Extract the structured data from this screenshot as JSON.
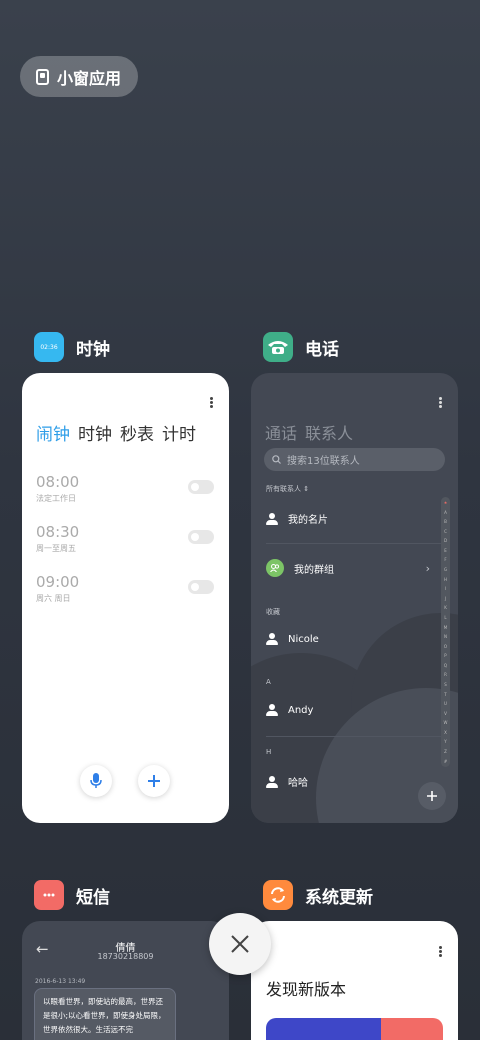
{
  "small_window": {
    "label": "小窗应用"
  },
  "apps": {
    "clock": {
      "name": "时钟",
      "icon_text": "02:36",
      "icon_color": "#36b8f0",
      "tabs": [
        "闹钟",
        "时钟",
        "秒表",
        "计时"
      ],
      "alarms": [
        {
          "time": "08:00",
          "days": "法定工作日",
          "enabled": false
        },
        {
          "time": "08:30",
          "days": "周一至周五",
          "enabled": false
        },
        {
          "time": "09:00",
          "days": "周六 周日",
          "enabled": false
        }
      ]
    },
    "phone": {
      "name": "电话",
      "icon_color": "#3fae88",
      "tabs": [
        "通话",
        "联系人"
      ],
      "search_placeholder": "搜索13位联系人",
      "all_contacts_label": "所有联系人",
      "my_card": "我的名片",
      "my_group": "我的群组",
      "favorites_label": "收藏",
      "contacts": [
        {
          "section": "",
          "name": "Nicole"
        },
        {
          "section": "A",
          "name": "Andy"
        },
        {
          "section": "H",
          "name": "哈哈"
        }
      ],
      "index_letters": [
        "★",
        "A",
        "B",
        "C",
        "D",
        "E",
        "F",
        "G",
        "H",
        "I",
        "J",
        "K",
        "L",
        "M",
        "N",
        "O",
        "P",
        "Q",
        "R",
        "S",
        "T",
        "U",
        "V",
        "W",
        "X",
        "Y",
        "Z",
        "#"
      ]
    },
    "sms": {
      "name": "短信",
      "icon_color": "#f26b66",
      "contact_name": "倩倩",
      "contact_number": "18730218809",
      "timestamp": "2016-6-13 13:49",
      "message": "以眼看世界，即使站的最高，世界还是很小;以心看世界，即使身处局限，世界依然很大。生活远不完"
    },
    "update": {
      "name": "系统更新",
      "icon_color": "#ff8a3d",
      "headline": "发现新版本"
    }
  }
}
